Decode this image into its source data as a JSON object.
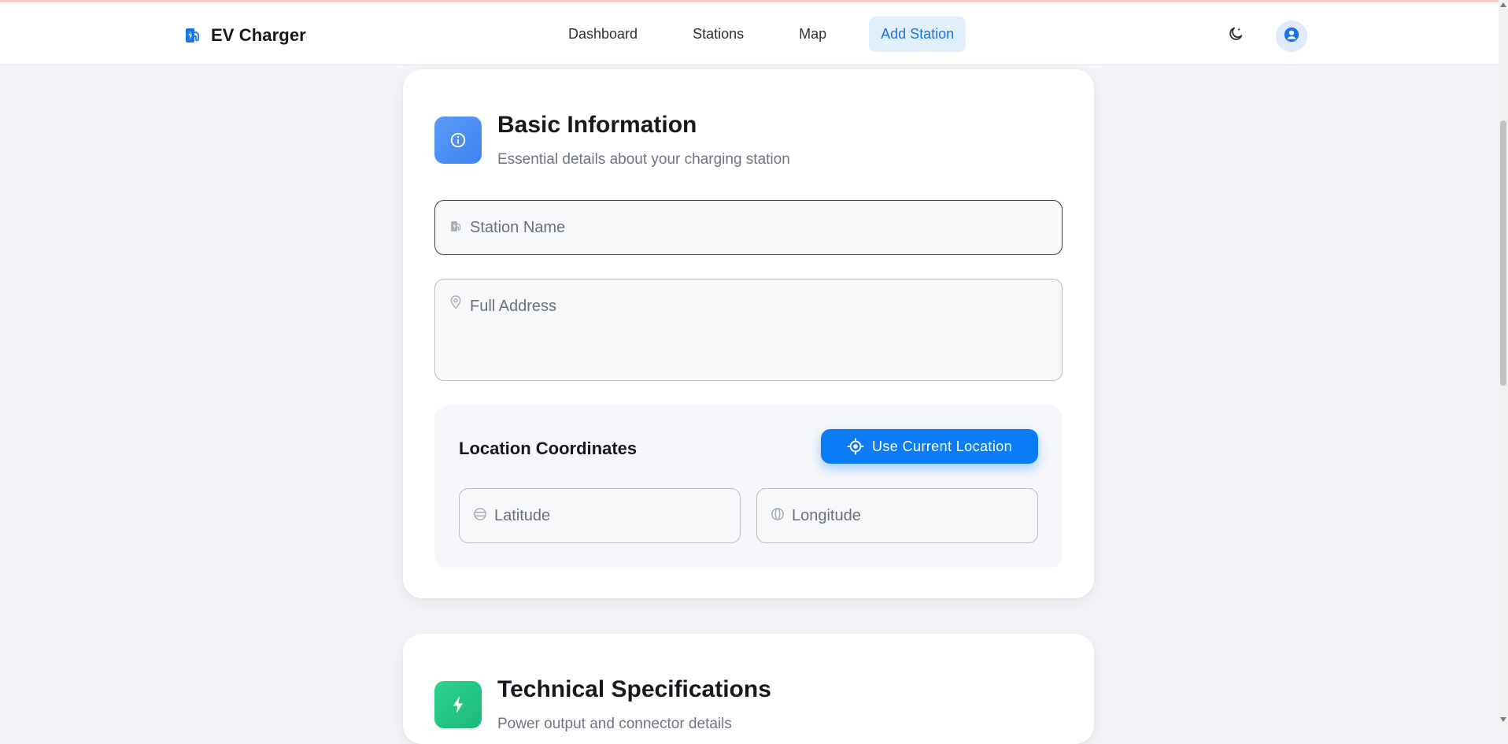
{
  "brand": {
    "name": "EV Charger",
    "icon": "ev-station-icon"
  },
  "nav": {
    "links": [
      {
        "label": "Dashboard"
      },
      {
        "label": "Stations"
      },
      {
        "label": "Map"
      },
      {
        "label": "Add Station",
        "active": true
      }
    ],
    "theme_icon": "moon-icon",
    "user_icon": "user-circle-icon"
  },
  "basic_info": {
    "icon": "info-icon",
    "title": "Basic Information",
    "subtitle": "Essential details about your charging station",
    "station_name": {
      "placeholder": "Station Name",
      "value": "",
      "icon": "ev-station-icon"
    },
    "address": {
      "placeholder": "Full Address",
      "value": "",
      "icon": "map-pin-icon"
    },
    "coordinates": {
      "title": "Location Coordinates",
      "use_location_label": "Use Current Location",
      "use_location_icon": "crosshair-icon",
      "latitude": {
        "placeholder": "Latitude",
        "value": "",
        "icon": "latitude-icon"
      },
      "longitude": {
        "placeholder": "Longitude",
        "value": "",
        "icon": "longitude-icon"
      }
    }
  },
  "tech_specs": {
    "icon": "bolt-icon",
    "title": "Technical Specifications",
    "subtitle": "Power output and connector details"
  },
  "colors": {
    "primary": "#0b7cf5",
    "nav_active_bg": "#e1effd",
    "nav_active_text": "#1a73e8",
    "basic_icon_bg": "#4a8ef4",
    "tech_icon_bg": "#22c583",
    "page_bg": "#f3f5f8"
  }
}
